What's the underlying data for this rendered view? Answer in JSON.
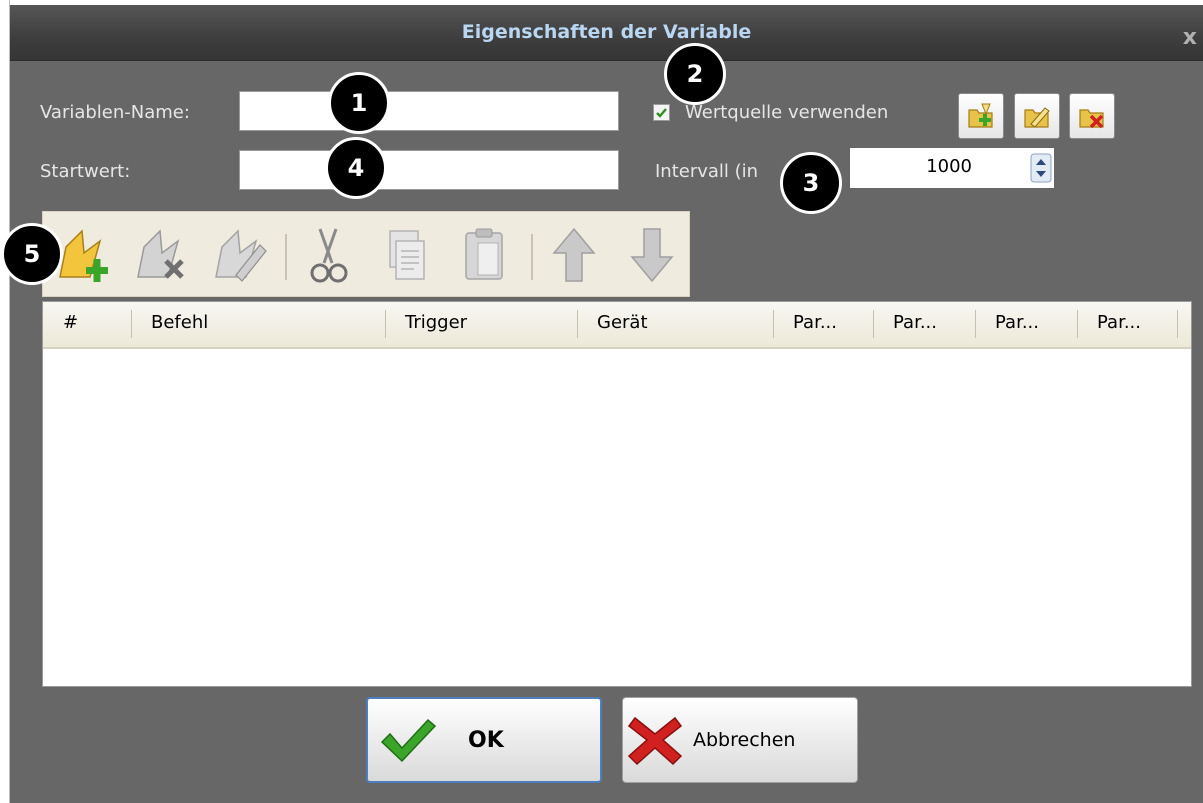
{
  "window": {
    "title": "Eigenschaften der Variable",
    "close_label": "x"
  },
  "form": {
    "variable_name_label": "Variablen-Name:",
    "variable_name_value": "",
    "start_value_label": "Startwert:",
    "start_value_value": "",
    "use_value_source_label": "Wertquelle verwenden",
    "use_value_source_checked": true,
    "interval_label": "Intervall (in",
    "interval_value": "1000"
  },
  "source_buttons": [
    {
      "icon": "folder-add-icon"
    },
    {
      "icon": "folder-edit-icon"
    },
    {
      "icon": "folder-delete-icon"
    }
  ],
  "toolbar": {
    "items": [
      {
        "icon": "new-command-icon",
        "enabled": true
      },
      {
        "icon": "delete-command-icon",
        "enabled": false
      },
      {
        "icon": "edit-command-icon",
        "enabled": false
      },
      {
        "icon": "cut-icon",
        "enabled": false
      },
      {
        "icon": "copy-icon",
        "enabled": false
      },
      {
        "icon": "paste-icon",
        "enabled": false
      },
      {
        "icon": "move-up-icon",
        "enabled": false
      },
      {
        "icon": "move-down-icon",
        "enabled": false
      }
    ]
  },
  "table": {
    "columns": [
      "#",
      "Befehl",
      "Trigger",
      "Gerät",
      "Par...",
      "Par...",
      "Par...",
      "Par..."
    ],
    "rows": []
  },
  "buttons": {
    "ok_label": "OK",
    "cancel_label": "Abbrechen"
  },
  "callouts": [
    "1",
    "2",
    "3",
    "4",
    "5"
  ],
  "colors": {
    "title_text": "#b9d6f2",
    "window_bg": "#676767",
    "callout_bg": "#000000",
    "ok_check": "#3aa529",
    "cancel_x": "#d02020"
  }
}
